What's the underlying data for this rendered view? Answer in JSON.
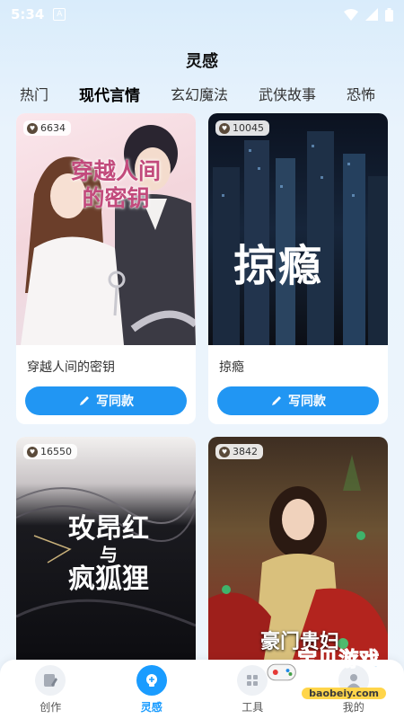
{
  "status": {
    "time": "5:34",
    "app_icon": "A"
  },
  "header": {
    "title": "灵感"
  },
  "tabs": [
    "热门",
    "现代言情",
    "玄幻魔法",
    "武侠故事",
    "恐怖"
  ],
  "cards": [
    {
      "count": "6634",
      "cover_title": "穿越人间的密钥",
      "name": "穿越人间的密钥",
      "button": "写同款"
    },
    {
      "count": "10045",
      "cover_title": "掠瘾",
      "name": "掠瘾",
      "button": "写同款"
    },
    {
      "count": "16550",
      "cover_title_line1": "玫昂红",
      "cover_title_line2": "与",
      "cover_title_line3": "疯狐狸"
    },
    {
      "count": "3842",
      "cover_title": "豪门贵妇"
    }
  ],
  "nav": [
    {
      "label": "创作",
      "icon": "edit-icon"
    },
    {
      "label": "灵感",
      "icon": "lightbulb-icon"
    },
    {
      "label": "工具",
      "icon": "tool-icon"
    },
    {
      "label": "我的",
      "icon": "user-icon"
    }
  ],
  "watermark": {
    "text": "宝贝游戏网",
    "url": "baobeiy.com"
  },
  "colors": {
    "accent": "#1a9cff",
    "button": "#2196f3"
  }
}
